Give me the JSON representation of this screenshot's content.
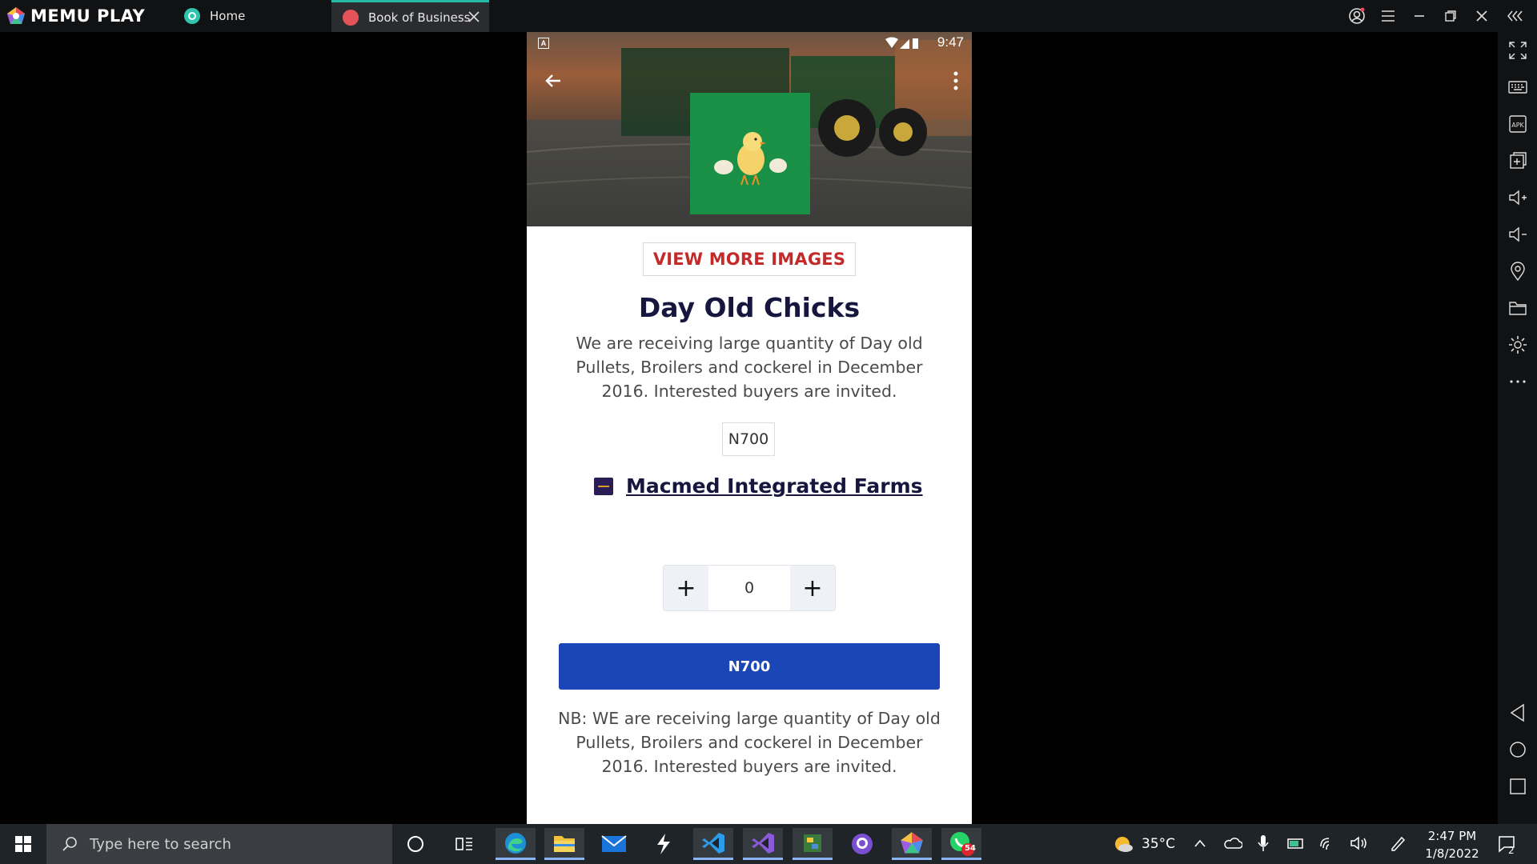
{
  "emulator": {
    "app_name": "MEMU PLAY",
    "tabs": [
      {
        "label": "Home",
        "icon": "memu-home-icon"
      },
      {
        "label": "Book of Business",
        "icon": "book-of-business-icon",
        "active": true
      }
    ],
    "sidebar_icons": [
      "fullscreen-icon",
      "keyboard-icon",
      "apk-icon",
      "add-window-icon",
      "volume-up-icon",
      "volume-down-icon",
      "location-icon",
      "folder-icon",
      "settings-icon",
      "more-icon",
      "android-back-icon",
      "android-home-icon",
      "android-recents-icon"
    ]
  },
  "phone": {
    "status_time": "9:47",
    "status_indicator": "A",
    "view_more_label": "VIEW MORE IMAGES",
    "product_title": "Day Old Chicks",
    "description": "We are receiving large quantity of Day old Pullets, Broilers and cockerel in December 2016. Interested buyers are invited.",
    "price": "N700",
    "seller_name": "Macmed Integrated Farms",
    "quantity": "0",
    "decrement_label": "+",
    "increment_label": "+",
    "buy_button_label": "N700",
    "note": "NB: WE are receiving large quantity of Day old Pullets, Broilers and cockerel in December 2016. Interested buyers are invited.",
    "colors": {
      "accent_red": "#c42a2a",
      "title_navy": "#16163f",
      "button_blue": "#1a46b8",
      "product_bg_green": "#199046"
    }
  },
  "taskbar": {
    "search_placeholder": "Type here to search",
    "weather_temp": "35°C",
    "time": "2:47 PM",
    "date": "1/8/2022",
    "whatsapp_badge": "54",
    "notification_count": "2",
    "pinned_apps": [
      "cortana-icon",
      "task-view-icon",
      "edge-icon",
      "file-explorer-icon",
      "mail-icon",
      "visual-studio-icon",
      "vscode-icon",
      "visual-studio-purple-icon",
      "python-icon",
      "github-desktop-icon",
      "memu-icon",
      "whatsapp-icon"
    ]
  }
}
